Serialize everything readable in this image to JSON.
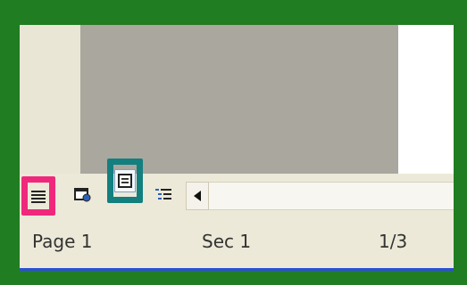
{
  "status_bar": {
    "page": "Page  1",
    "section": "Sec  1",
    "position": "1/3"
  },
  "view_buttons": {
    "normal": "normal-view-icon",
    "web": "web-layout-icon",
    "print": "print-layout-icon",
    "outline": "outline-view-icon"
  },
  "colors": {
    "frame": "#207d21",
    "normal_highlight": "#f0287c",
    "print_highlight": "#137f7f",
    "document_gray": "#aaa79f"
  }
}
